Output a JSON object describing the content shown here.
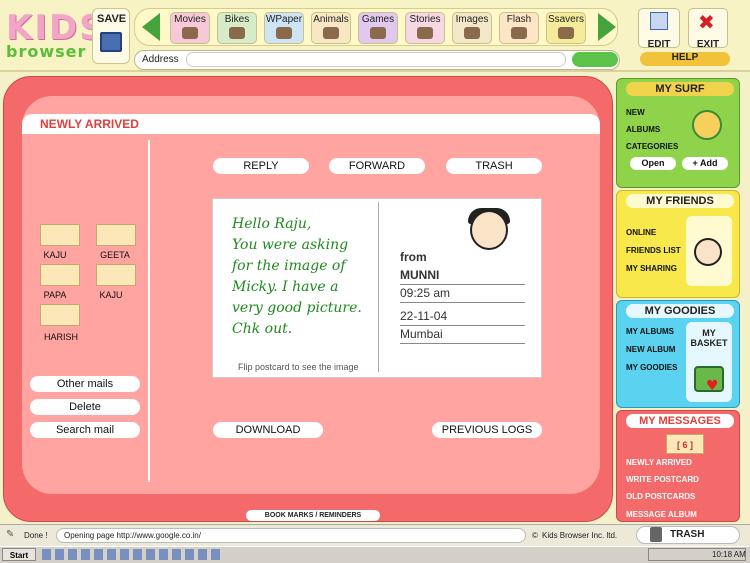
{
  "logo": {
    "line1": "KIDS",
    "line2": "browser"
  },
  "toolbar": {
    "save": "SAVE",
    "edit": "EDIT",
    "exit": "EXIT",
    "help": "HELP"
  },
  "nav": [
    {
      "label": "Movies",
      "color": "#f6c8d8"
    },
    {
      "label": "Bikes",
      "color": "#d6ecc8"
    },
    {
      "label": "WPaper",
      "color": "#cde4f6"
    },
    {
      "label": "Animals",
      "color": "#f7e7c3"
    },
    {
      "label": "Games",
      "color": "#e2c7ee"
    },
    {
      "label": "Stories",
      "color": "#f8d7e4"
    },
    {
      "label": "Images",
      "color": "#f2e8c8"
    },
    {
      "label": "Flash",
      "color": "#fde6c6"
    },
    {
      "label": "Ssavers",
      "color": "#f4ec9a"
    }
  ],
  "address": {
    "label": "Address",
    "value": ""
  },
  "section_title": "NEWLY ARRIVED",
  "actions": {
    "reply": "REPLY",
    "forward": "FORWARD",
    "trash": "TRASH",
    "download": "DOWNLOAD",
    "previous": "PREVIOUS LOGS"
  },
  "senders": [
    "KAJU",
    "GEETA",
    "PAPA",
    "KAJU",
    "HARISH"
  ],
  "leftbtns": {
    "other": "Other mails",
    "delete": "Delete",
    "search": "Search mail"
  },
  "postcard": {
    "lines": [
      "Hello Raju,",
      "You were asking",
      "for the image of",
      "Micky. I have a",
      "very good picture.",
      "Chk out."
    ],
    "flip": "Flip postcard to see the image",
    "from_label": "from",
    "from_name": "MUNNI",
    "time": "09:25 am",
    "date": "22-11-04",
    "place": "Mumbai"
  },
  "bookmarks": "BOOK MARKS / REMINDERS",
  "mysurf": {
    "title": "MY SURF",
    "items": [
      "NEW",
      "ALBUMS",
      "CATEGORIES"
    ],
    "open": "Open",
    "add": "+ Add"
  },
  "myfriends": {
    "title": "MY FRIENDS",
    "items": [
      "ONLINE",
      "FRIENDS LIST",
      "MY SHARING"
    ]
  },
  "mygoodies": {
    "title": "MY GOODIES",
    "items": [
      "MY ALBUMS",
      "NEW ALBUM",
      "MY GOODIES"
    ],
    "basket": "MY BASKET"
  },
  "mymessages": {
    "title": "MY MESSAGES",
    "count": "[ 6 ]",
    "items": [
      "NEWLY ARRIVED",
      "WRITE POSTCARD",
      "OLD POSTCARDS",
      "MESSAGE ALBUM"
    ]
  },
  "trash_label": "TRASH",
  "status": {
    "done": "Done !",
    "opening": "Opening page http://www.google.co.in/",
    "copyright": "Kids Browser Inc. ltd."
  },
  "taskbar": {
    "start": "Start",
    "time": "10:18 AM"
  }
}
